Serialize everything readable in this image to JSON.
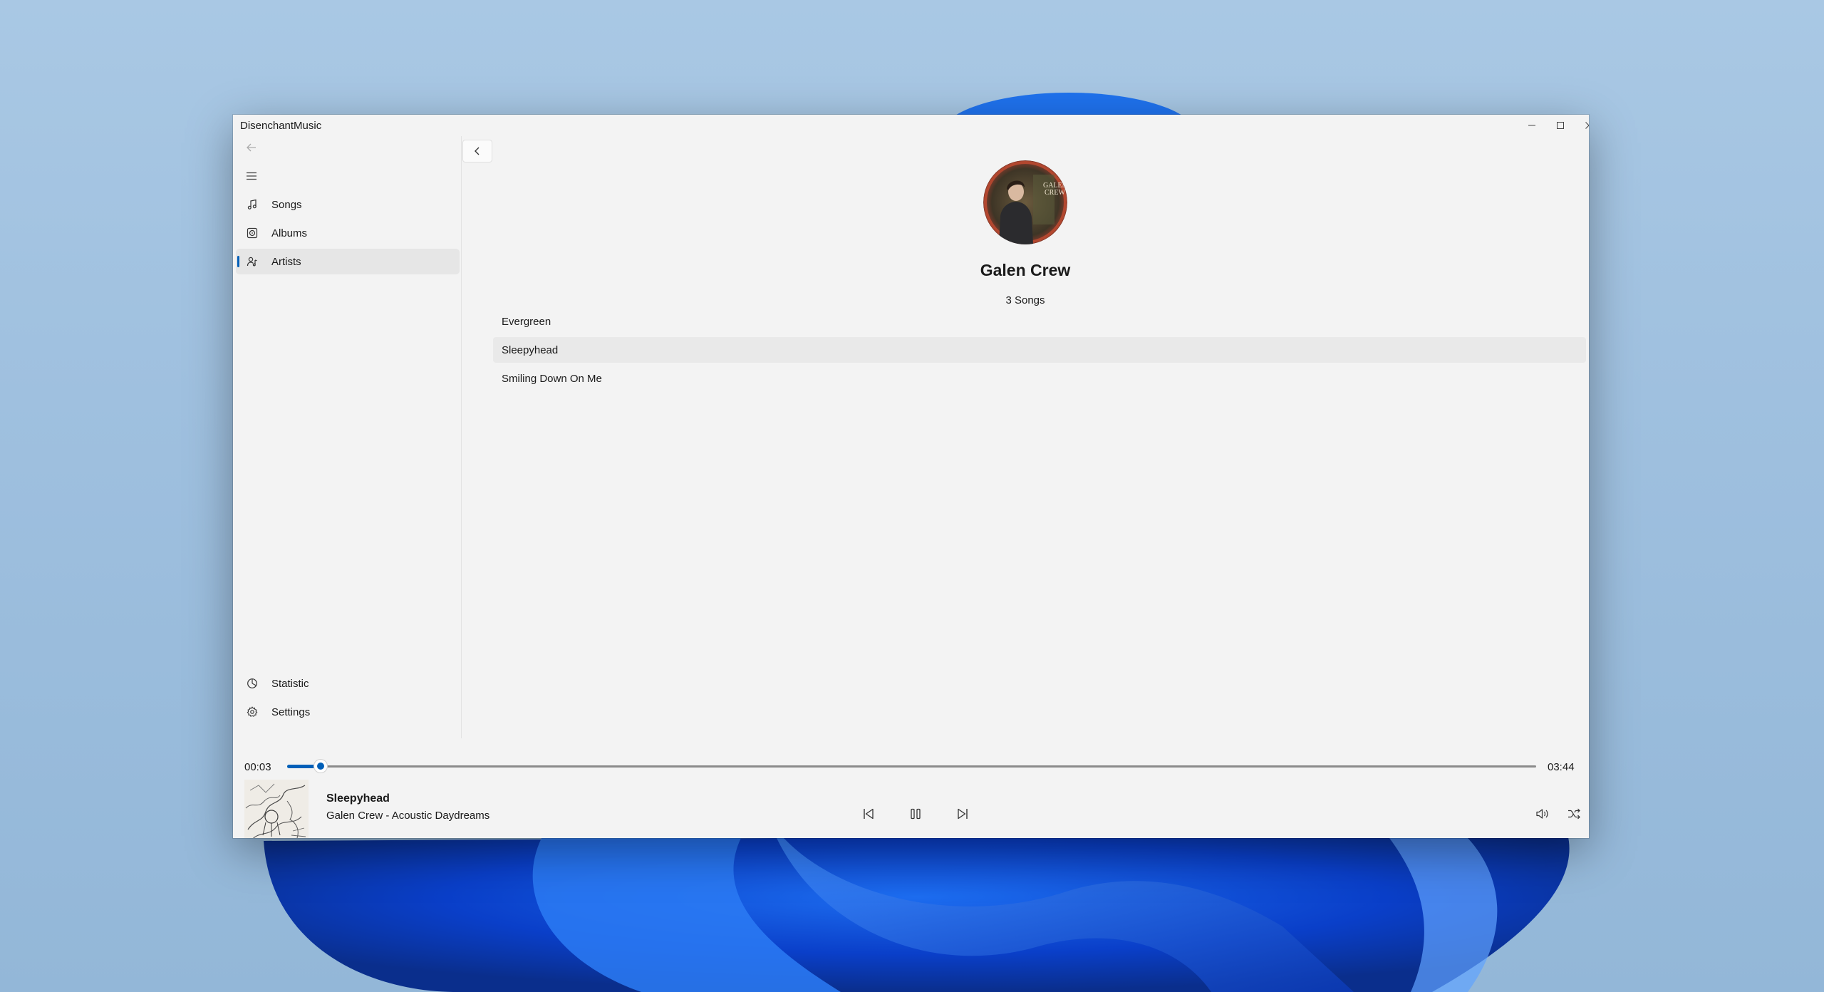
{
  "app": {
    "title": "DisenchantMusic"
  },
  "sidebar": {
    "items": [
      {
        "label": "Songs",
        "icon": "music-note-icon"
      },
      {
        "label": "Albums",
        "icon": "album-icon"
      },
      {
        "label": "Artists",
        "icon": "artist-icon",
        "selected": true
      }
    ],
    "footer_items": [
      {
        "label": "Statistic",
        "icon": "pie-chart-icon"
      },
      {
        "label": "Settings",
        "icon": "gear-icon"
      }
    ]
  },
  "artist": {
    "name": "Galen Crew",
    "song_count": "3 Songs",
    "songs": [
      "Evergreen",
      "Sleepyhead",
      "Smiling Down On Me"
    ]
  },
  "player": {
    "elapsed": "00:03",
    "duration": "03:44",
    "progress_fraction": 0.015,
    "title": "Sleepyhead",
    "subtitle": "Galen Crew - Acoustic Daydreams"
  },
  "colors": {
    "accent": "#005fb8",
    "window_bg": "#f3f3f3",
    "selected_bg": "#e6e6e6"
  }
}
